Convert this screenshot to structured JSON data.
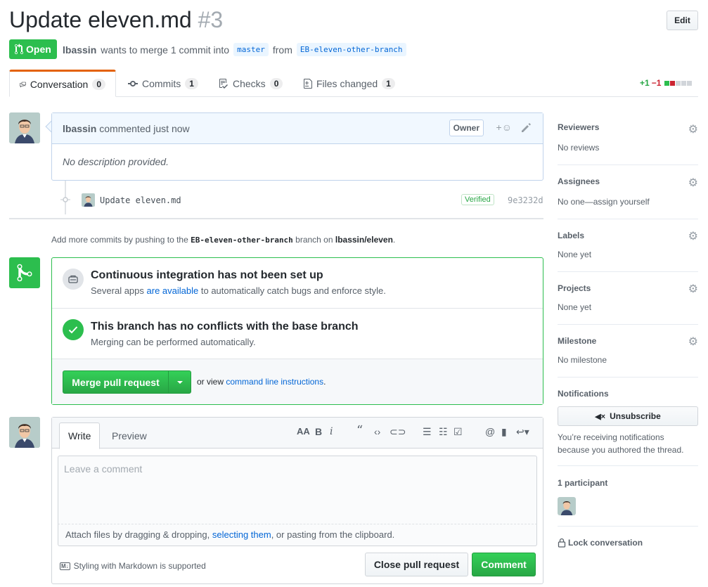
{
  "header": {
    "title": "Update eleven.md",
    "number": "#3",
    "edit_label": "Edit",
    "state": "Open",
    "author": "lbassin",
    "merge_text": "wants to merge 1 commit into",
    "base_branch": "master",
    "from_text": "from",
    "head_branch": "EB-eleven-other-branch"
  },
  "tabs": [
    {
      "label": "Conversation",
      "count": "0"
    },
    {
      "label": "Commits",
      "count": "1"
    },
    {
      "label": "Checks",
      "count": "0"
    },
    {
      "label": "Files changed",
      "count": "1"
    }
  ],
  "diffstat": {
    "additions": "+1",
    "deletions": "−1"
  },
  "comment": {
    "author": "lbassin",
    "action": "commented just now",
    "badge": "Owner",
    "body": "No description provided."
  },
  "commit": {
    "message": "Update eleven.md",
    "verified": "Verified",
    "sha": "9e3232d"
  },
  "push_hint": {
    "prefix": "Add more commits by pushing to the",
    "branch": "EB-eleven-other-branch",
    "middle": "branch on",
    "repo": "lbassin/eleven",
    "suffix": "."
  },
  "merge": {
    "ci_title": "Continuous integration has not been set up",
    "ci_sub_prefix": "Several apps",
    "ci_sub_link": "are available",
    "ci_sub_suffix": "to automatically catch bugs and enforce style.",
    "conflict_title": "This branch has no conflicts with the base branch",
    "conflict_sub": "Merging can be performed automatically.",
    "button": "Merge pull request",
    "or_view": "or view",
    "cli_link": "command line instructions",
    "period": "."
  },
  "new_comment": {
    "write_tab": "Write",
    "preview_tab": "Preview",
    "placeholder": "Leave a comment",
    "attach_prefix": "Attach files by dragging & dropping,",
    "attach_link": "selecting them",
    "attach_suffix": ", or pasting from the clipboard.",
    "markdown_note": "Styling with Markdown is supported",
    "close_button": "Close pull request",
    "comment_button": "Comment"
  },
  "sidebar": {
    "reviewers": {
      "label": "Reviewers",
      "value": "No reviews"
    },
    "assignees": {
      "label": "Assignees",
      "value": "No one—assign yourself"
    },
    "labels": {
      "label": "Labels",
      "value": "None yet"
    },
    "projects": {
      "label": "Projects",
      "value": "None yet"
    },
    "milestone": {
      "label": "Milestone",
      "value": "No milestone"
    },
    "notifications": {
      "label": "Notifications",
      "button": "Unsubscribe",
      "reason": "You’re receiving notifications because you authored the thread."
    },
    "participants": "1 participant",
    "lock": "Lock conversation"
  },
  "colors": {
    "open_green": "#2cbe4e",
    "link_blue": "#0366d6",
    "tab_accent": "#e36209",
    "diff_add": "#28a745",
    "diff_del": "#cb2431"
  }
}
